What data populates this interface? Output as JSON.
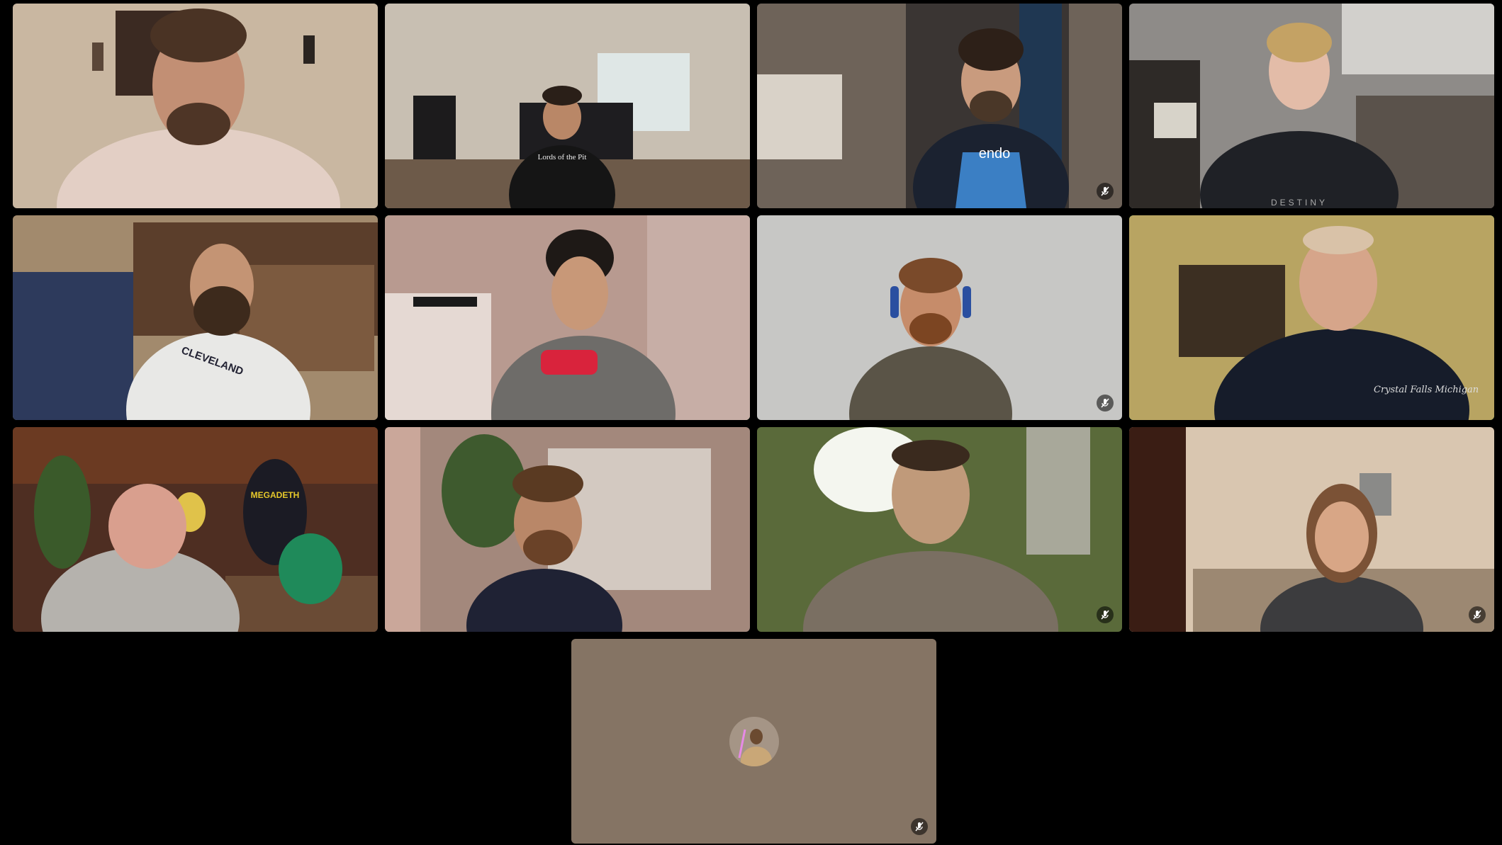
{
  "meeting": {
    "layout": "gallery",
    "participant_count": 13,
    "accent_speaking": "#2bd46a",
    "background": "#000000"
  },
  "participants": [
    {
      "id": "p1",
      "shirt": "Lords of the Pit",
      "muted": false
    },
    {
      "id": "p2",
      "shirt": "",
      "muted": false
    },
    {
      "id": "p3",
      "shirt": "",
      "muted": true
    },
    {
      "id": "p4",
      "shirt": "DESTINY",
      "muted": false
    },
    {
      "id": "p5",
      "shirt": "CLEVELAND",
      "muted": false
    },
    {
      "id": "p6",
      "shirt": "",
      "muted": false,
      "speaking": true
    },
    {
      "id": "p7",
      "shirt": "",
      "muted": true
    },
    {
      "id": "p8",
      "shirt": "",
      "muted": false,
      "speaking": true
    },
    {
      "id": "p9",
      "shirt": "MEGADETH",
      "muted": false
    },
    {
      "id": "p10",
      "shirt": "",
      "muted": false
    },
    {
      "id": "p11",
      "shirt": "",
      "muted": true
    },
    {
      "id": "p12",
      "shirt": "",
      "muted": true
    },
    {
      "id": "p13",
      "shirt": "",
      "muted": true,
      "video_off": true,
      "avatar": "jedi-avatar"
    }
  ],
  "labels": {
    "tile2_shirt": "Lords of the Pit",
    "tile4_shirt": "DESTINY",
    "tile5_shirt": "CLEVELAND",
    "tile9_shirt": "MEGADETH",
    "tile3_shirt": "endo",
    "tile8_shirt": "Crystal Falls Michigan"
  },
  "icons": {
    "mute": "mic-muted-icon",
    "avatar": "jedi-avatar-icon"
  }
}
